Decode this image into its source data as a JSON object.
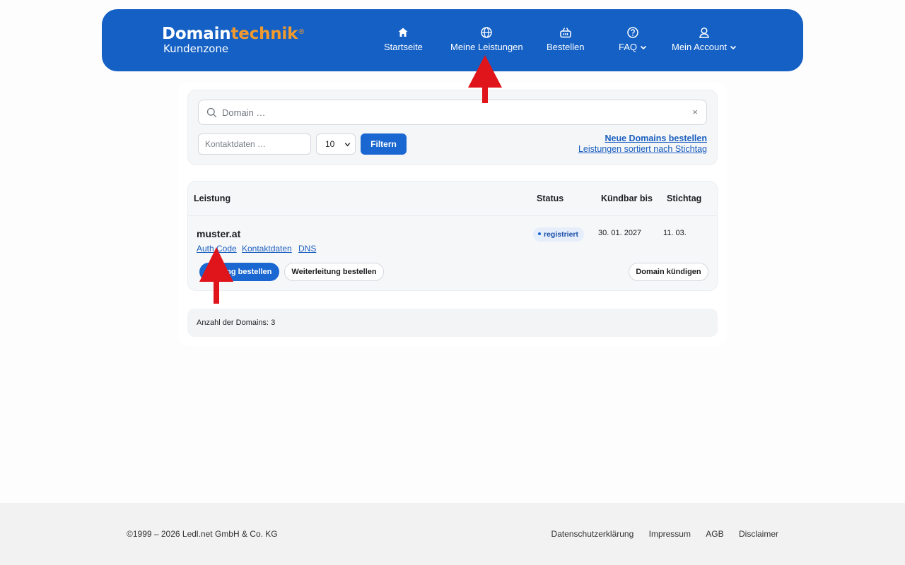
{
  "brand": {
    "logo_main": "Domain",
    "logo_accent": "technik",
    "logo_mark": "®",
    "logo_sub": "Kundenzone"
  },
  "nav": {
    "items": [
      {
        "label": "Startseite",
        "icon": "home-icon"
      },
      {
        "label": "Meine Leistungen",
        "icon": "globe-icon"
      },
      {
        "label": "Bestellen",
        "icon": "basket-icon"
      },
      {
        "label": "FAQ",
        "icon": "help-circle-icon",
        "dropdown": true
      },
      {
        "label": "Mein Account",
        "icon": "user-icon",
        "dropdown": true
      }
    ]
  },
  "filter": {
    "search_placeholder": "Domain …",
    "clear_label": "×",
    "contact_placeholder": "Kontaktdaten …",
    "per_page_value": "10",
    "filter_button": "Filtern",
    "link_new_domains": "Neue Domains bestellen",
    "link_sorted": "Leistungen sortiert nach Stichtag"
  },
  "table": {
    "headers": {
      "service": "Leistung",
      "status": "Status",
      "cancelable_until": "Kündbar bis",
      "due_date": "Stichtag"
    },
    "rows": [
      {
        "domain": "muster.at",
        "links": [
          "Auth Code",
          "Kontaktdaten",
          "DNS"
        ],
        "status": "registriert",
        "cancelable_until": "30. 01. 2027",
        "due_date": "11. 03.",
        "actions": {
          "primary": "Hosting bestellen",
          "secondary": "Weiterleitung bestellen",
          "cancel": "Domain kündigen"
        }
      }
    ]
  },
  "summary": {
    "domain_count_text": "Anzahl der Domains: 3"
  },
  "footer": {
    "copyright": "©1999 – 2026 Ledl.net GmbH & Co. KG",
    "links": [
      "Datenschutzerklärung",
      "Impressum",
      "AGB",
      "Disclaimer"
    ]
  },
  "colors": {
    "header_blue": "#1460c4",
    "accent_orange": "#f29a2e",
    "button_blue": "#1a67d2",
    "annotation_red": "#e0141b"
  }
}
